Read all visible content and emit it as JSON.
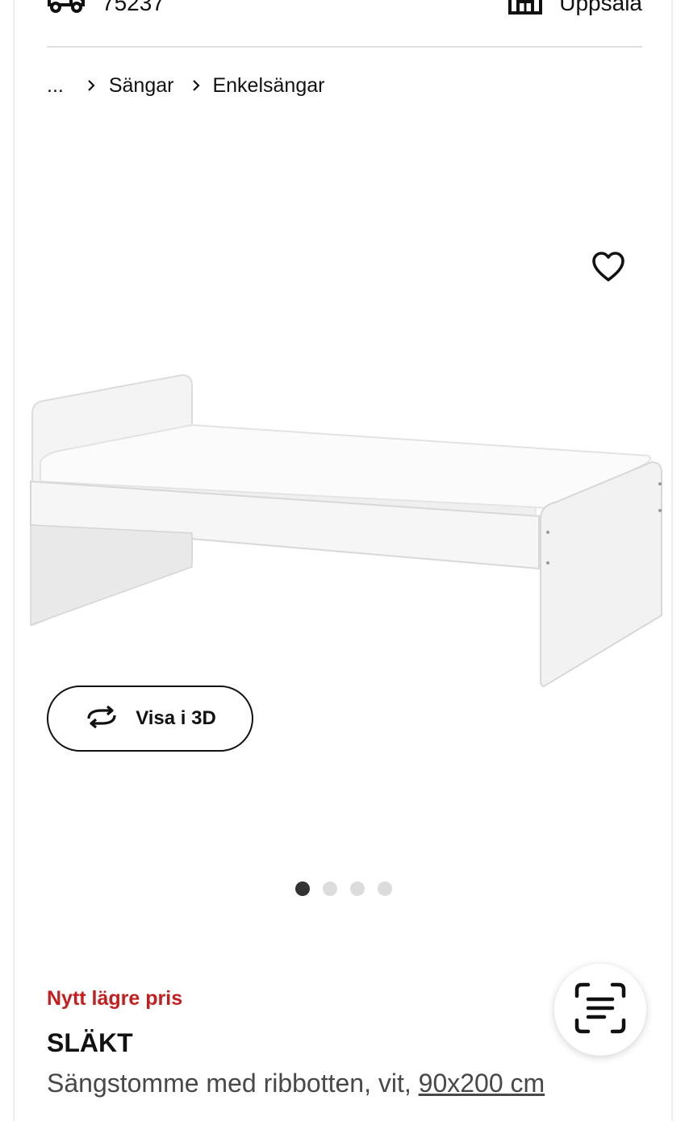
{
  "header": {
    "delivery_code": "75237",
    "store_name": "Uppsala",
    "delivery_icon": "truck-icon",
    "store_icon": "store-icon"
  },
  "breadcrumb": {
    "ellipsis": "...",
    "items": [
      "Sängar",
      "Enkelsängar"
    ]
  },
  "gallery": {
    "favorite_icon": "heart-icon",
    "view_3d_label": "Visa i 3D",
    "view_3d_icon": "rotate-3d-icon",
    "image_count": 4,
    "active_image": 1
  },
  "product": {
    "promo_label": "Nytt lägre pris",
    "name": "SLÄKT",
    "description": "Sängstomme med ribbotten, vit, ",
    "size": "90x200 cm"
  },
  "floating": {
    "scan_icon": "scan-text-icon"
  },
  "colors": {
    "promo_red": "#c41e1e",
    "text_dark": "#111111",
    "text_grey": "#484848"
  }
}
